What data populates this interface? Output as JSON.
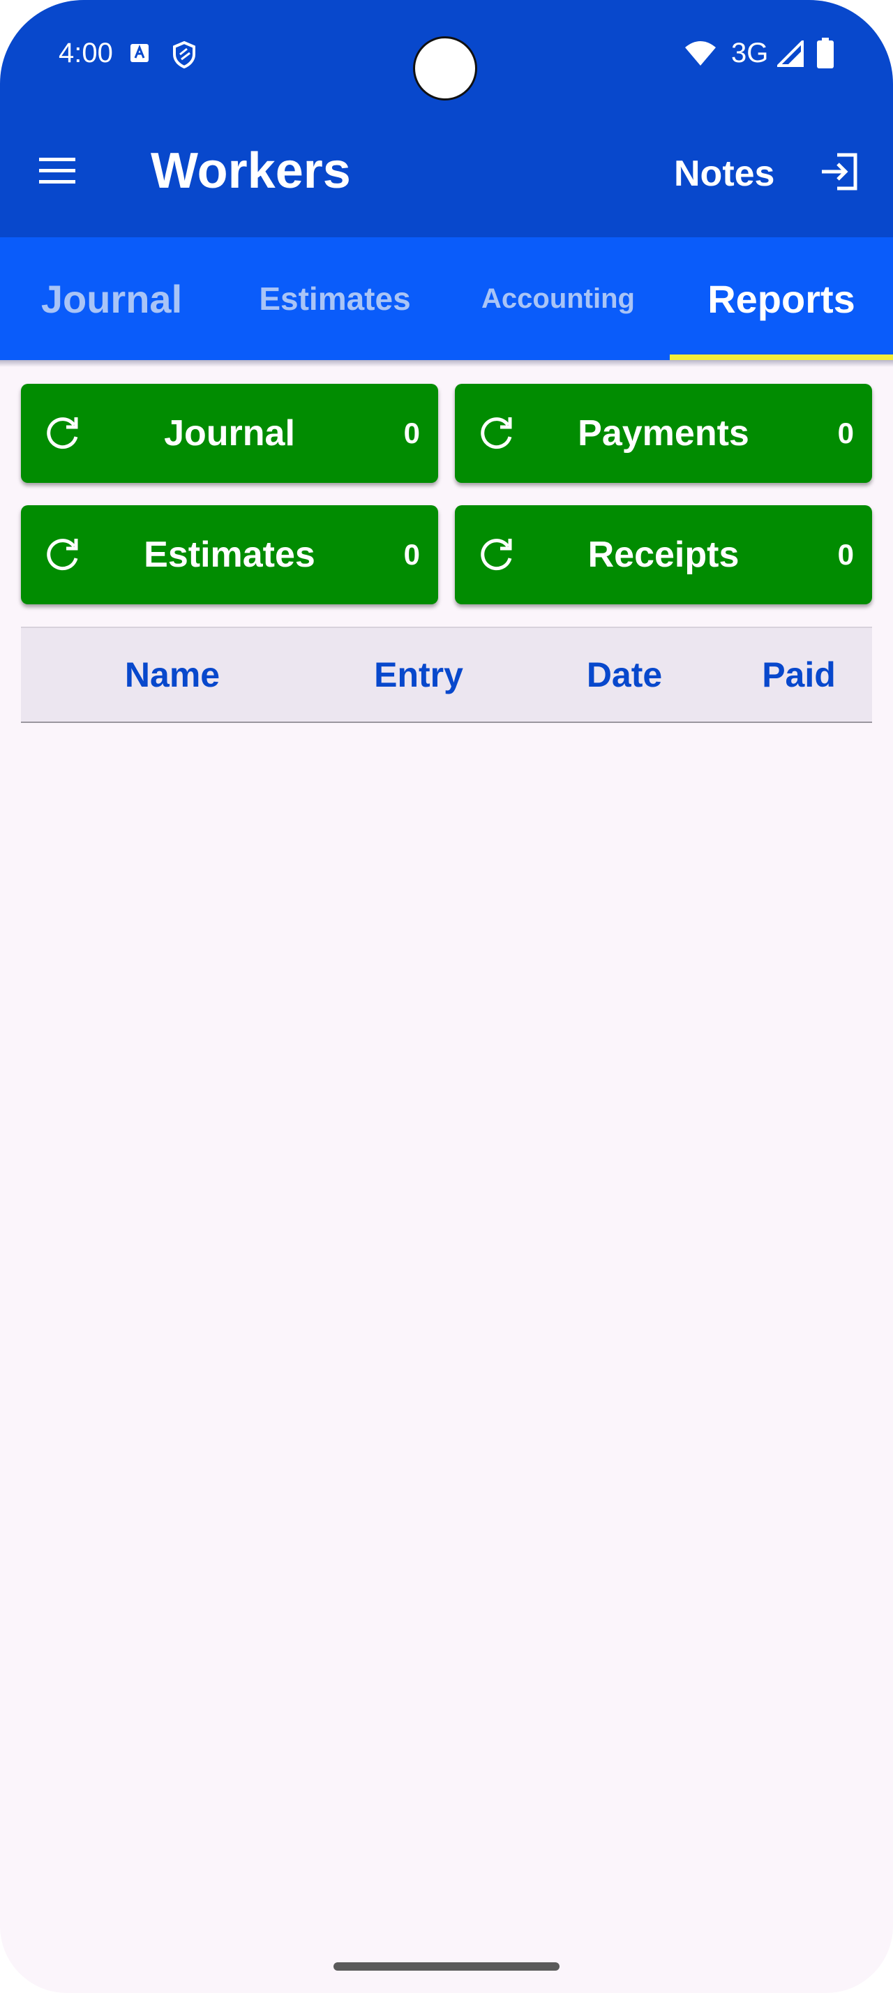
{
  "status_bar": {
    "time": "4:00",
    "network": "3G",
    "icons": [
      "a-badge-icon",
      "shield-icon",
      "wifi-icon",
      "signal-icon",
      "battery-icon"
    ]
  },
  "app_bar": {
    "title": "Workers",
    "notes_label": "Notes",
    "icons": [
      "menu-icon",
      "exit-icon"
    ]
  },
  "tabs": [
    {
      "label": "Journal",
      "active": false
    },
    {
      "label": "Estimates",
      "active": false
    },
    {
      "label": "Accounting",
      "active": false
    },
    {
      "label": "Reports",
      "active": true
    }
  ],
  "report_buttons": [
    {
      "label": "Journal",
      "count": "0",
      "icon": "refresh-icon"
    },
    {
      "label": "Payments",
      "count": "0",
      "icon": "refresh-icon"
    },
    {
      "label": "Estimates",
      "count": "0",
      "icon": "refresh-icon"
    },
    {
      "label": "Receipts",
      "count": "0",
      "icon": "refresh-icon"
    }
  ],
  "table": {
    "columns": [
      "Name",
      "Entry",
      "Date",
      "Paid"
    ],
    "rows": []
  },
  "colors": {
    "app_bar": "#0848cc",
    "tab_bar": "#0a5cfa",
    "tab_indicator": "#f2ee3a",
    "button_green": "#018c01",
    "header_text": "#0848cc",
    "background": "#fbf5fb"
  }
}
